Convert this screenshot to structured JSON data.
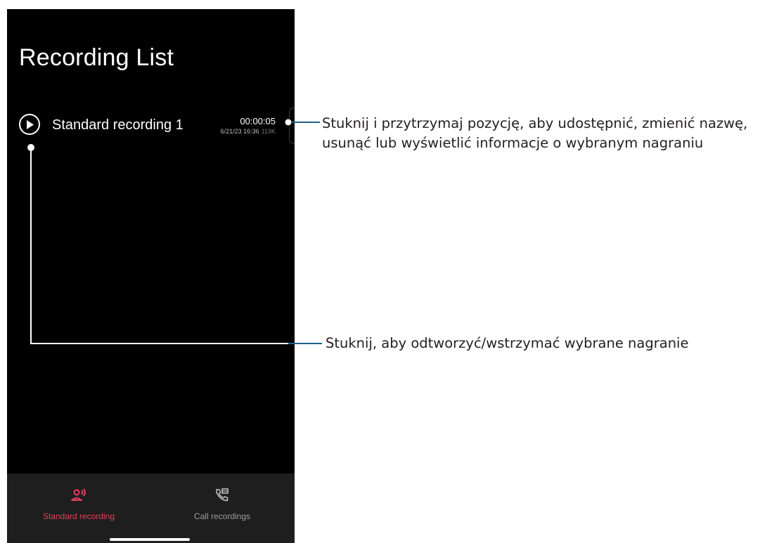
{
  "screen": {
    "title": "Recording List"
  },
  "recordings": [
    {
      "name": "Standard recording 1",
      "duration": "00:00:05",
      "date": "6/21/23 16:36",
      "size": "119K"
    }
  ],
  "bottom_nav": {
    "tabs": [
      {
        "label": "Standard recording",
        "icon": "voice-recording-icon",
        "active": true
      },
      {
        "label": "Call recordings",
        "icon": "call-recording-icon",
        "active": false
      }
    ]
  },
  "callouts": {
    "long_press_line1": "Stuknij i przytrzymaj pozycję, aby udostępnić, zmienić nazwę,",
    "long_press_line2": "usunąć lub wyświetlić informacje o wybranym nagraniu",
    "tap_play": "Stuknij, aby odtworzyć/wstrzymać wybrane nagranie"
  },
  "colors": {
    "accent": "#e8405c",
    "background": "#000000",
    "nav_background": "#1e1e1e"
  }
}
